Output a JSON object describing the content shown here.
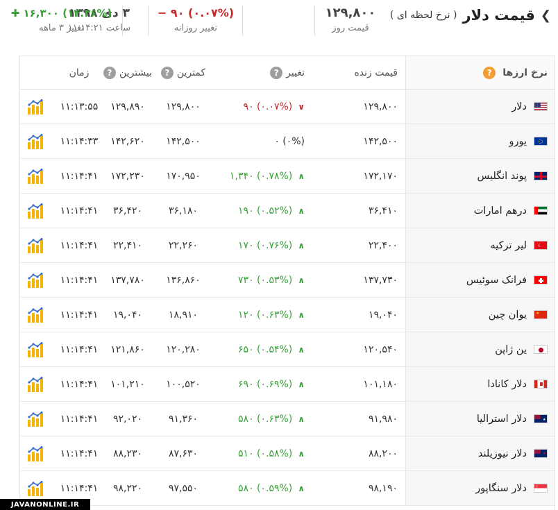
{
  "header": {
    "title": "قیمت دلار",
    "subtitle": "( نرخ لحظه ای )",
    "day_price": {
      "value": "۱۲۹,۸۰۰",
      "label": "قیمت روز"
    },
    "daily_change": {
      "value": "(۰.۰۷%) ۹۰ −",
      "label": "تغییر روزانه"
    },
    "date_block": {
      "value": "۳ دی ۱۳۹۸",
      "label": "ساعت ۱۱:۱۴:۲۱"
    },
    "three_month": {
      "value": "(۱۴.۳۶%) ۱۶,۳۰۰ ✚",
      "label": "تغییر ۳ ماهه"
    }
  },
  "colors": {
    "green": "#37a137",
    "red": "#c62828",
    "orange": "#f39c34"
  },
  "table": {
    "headers": {
      "name": "نرخ ارزها",
      "live": "قیمت زنده",
      "change": "تغییر",
      "min": "کمترین",
      "max": "بیشترین",
      "time": "زمان"
    },
    "rows": [
      {
        "name": "دلار",
        "flag": "us-flag",
        "live": "۱۲۹,۸۰۰",
        "change": "(۰.۰۷%) ۹۰",
        "dir": "down",
        "min": "۱۲۹,۸۰۰",
        "max": "۱۲۹,۸۹۰",
        "time": "۱۱:۱۳:۵۵"
      },
      {
        "name": "یورو",
        "flag": "eu-flag",
        "live": "۱۴۲,۵۰۰",
        "change": "(۰%) ۰",
        "dir": "none",
        "min": "۱۴۲,۵۰۰",
        "max": "۱۴۲,۶۲۰",
        "time": "۱۱:۱۴:۳۳"
      },
      {
        "name": "پوند انگلیس",
        "flag": "uk-flag",
        "live": "۱۷۲,۱۷۰",
        "change": "(۰.۷۸%) ۱,۳۴۰",
        "dir": "up",
        "min": "۱۷۰,۹۵۰",
        "max": "۱۷۲,۲۳۰",
        "time": "۱۱:۱۴:۴۱"
      },
      {
        "name": "درهم امارات",
        "flag": "uae-flag",
        "live": "۳۶,۴۱۰",
        "change": "(۰.۵۲%) ۱۹۰",
        "dir": "up",
        "min": "۳۶,۱۸۰",
        "max": "۳۶,۴۲۰",
        "time": "۱۱:۱۴:۴۱"
      },
      {
        "name": "لیر ترکیه",
        "flag": "tr-flag",
        "live": "۲۲,۴۰۰",
        "change": "(۰.۷۶%) ۱۷۰",
        "dir": "up",
        "min": "۲۲,۲۶۰",
        "max": "۲۲,۴۱۰",
        "time": "۱۱:۱۴:۴۱"
      },
      {
        "name": "فرانک سوئیس",
        "flag": "ch-flag",
        "live": "۱۳۷,۷۳۰",
        "change": "(۰.۵۳%) ۷۳۰",
        "dir": "up",
        "min": "۱۳۶,۸۶۰",
        "max": "۱۳۷,۷۸۰",
        "time": "۱۱:۱۴:۴۱"
      },
      {
        "name": "یوان چین",
        "flag": "cn-flag",
        "live": "۱۹,۰۴۰",
        "change": "(۰.۶۳%) ۱۲۰",
        "dir": "up",
        "min": "۱۸,۹۱۰",
        "max": "۱۹,۰۴۰",
        "time": "۱۱:۱۴:۴۱"
      },
      {
        "name": "ین ژاپن",
        "flag": "jp-flag",
        "live": "۱۲۰,۵۴۰",
        "change": "(۰.۵۴%) ۶۵۰",
        "dir": "up",
        "min": "۱۲۰,۲۸۰",
        "max": "۱۲۱,۸۶۰",
        "time": "۱۱:۱۴:۴۱"
      },
      {
        "name": "دلار کانادا",
        "flag": "ca-flag",
        "live": "۱۰۱,۱۸۰",
        "change": "(۰.۶۹%) ۶۹۰",
        "dir": "up",
        "min": "۱۰۰,۵۲۰",
        "max": "۱۰۱,۲۱۰",
        "time": "۱۱:۱۴:۴۱"
      },
      {
        "name": "دلار استرالیا",
        "flag": "au-flag",
        "live": "۹۱,۹۸۰",
        "change": "(۰.۶۳%) ۵۸۰",
        "dir": "up",
        "min": "۹۱,۳۶۰",
        "max": "۹۲,۰۲۰",
        "time": "۱۱:۱۴:۴۱"
      },
      {
        "name": "دلار نیوزیلند",
        "flag": "nz-flag",
        "live": "۸۸,۲۰۰",
        "change": "(۰.۵۸%) ۵۱۰",
        "dir": "up",
        "min": "۸۷,۶۳۰",
        "max": "۸۸,۲۳۰",
        "time": "۱۱:۱۴:۴۱"
      },
      {
        "name": "دلار سنگاپور",
        "flag": "sg-flag",
        "live": "۹۸,۱۹۰",
        "change": "(۰.۵۹%) ۵۸۰",
        "dir": "up",
        "min": "۹۷,۵۵۰",
        "max": "۹۸,۲۲۰",
        "time": "۱۱:۱۴:۴۱"
      }
    ]
  },
  "watermark": "JAVANONLINE.IR"
}
